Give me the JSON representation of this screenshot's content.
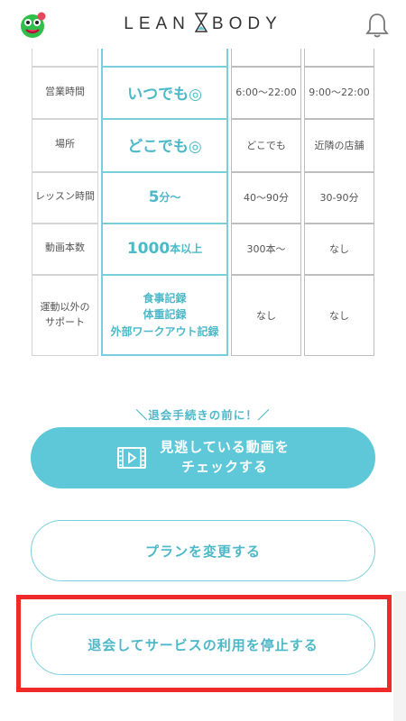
{
  "header": {
    "logo_left": "LEAN",
    "logo_right": "BODY",
    "avatar_icon": "green-character-avatar-icon",
    "bell_icon": "bell-icon"
  },
  "comparison": {
    "rows": [
      {
        "label": "営業時間",
        "lean": "いつでも◎",
        "a": "6:00〜22:00",
        "b": "9:00〜22:00"
      },
      {
        "label": "場所",
        "lean": "どこでも◎",
        "a": "どこでも",
        "b": "近隣の店舗"
      },
      {
        "label": "レッスン時間",
        "lean_main": "5",
        "lean_unit": "分〜",
        "a": "40〜90分",
        "b": "30-90分"
      },
      {
        "label": "動画本数",
        "lean_main": "1000",
        "lean_unit": "本以上",
        "a": "300本〜",
        "b": "なし"
      },
      {
        "label_l1": "運動以外の",
        "label_l2": "サポート",
        "lean_l1": "食事記録",
        "lean_l2": "体重記録",
        "lean_l3": "外部ワークアウト記録",
        "a": "なし",
        "b": "なし"
      }
    ]
  },
  "cta": {
    "note": "＼退会手続きの前に！／",
    "primary_l1": "見逃している動画を",
    "primary_l2": "チェックする",
    "primary_icon": "video-icon",
    "plan": "プランを変更する",
    "cancel": "退会してサービスの利用を停止する"
  },
  "colors": {
    "accent": "#5ec8d8",
    "highlight": "#ee2a2a"
  }
}
